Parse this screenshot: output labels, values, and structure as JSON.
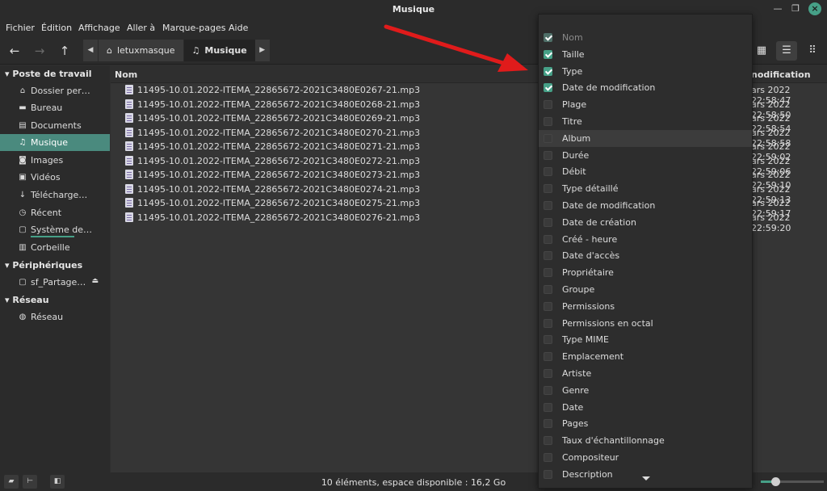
{
  "window": {
    "title": "Musique"
  },
  "menu": [
    "Fichier",
    "Édition",
    "Affichage",
    "Aller à",
    "Marque-pages",
    "Aide"
  ],
  "breadcrumbs": [
    {
      "label": "letuxmasque",
      "icon": "home-icon"
    },
    {
      "label": "Musique",
      "icon": "music-note-icon"
    }
  ],
  "sidebar": {
    "sections": [
      {
        "title": "Poste de travail",
        "items": [
          {
            "label": "Dossier per…",
            "icon": "home-folder-icon"
          },
          {
            "label": "Bureau",
            "icon": "desktop-icon"
          },
          {
            "label": "Documents",
            "icon": "documents-icon"
          },
          {
            "label": "Musique",
            "icon": "music-note-icon",
            "selected": true
          },
          {
            "label": "Images",
            "icon": "camera-icon"
          },
          {
            "label": "Vidéos",
            "icon": "video-icon"
          },
          {
            "label": "Télécharge…",
            "icon": "download-icon"
          },
          {
            "label": "Récent",
            "icon": "history-icon"
          },
          {
            "label": "Système de…",
            "icon": "drive-icon"
          },
          {
            "label": "Corbeille",
            "icon": "trash-icon"
          }
        ]
      },
      {
        "title": "Périphériques",
        "items": [
          {
            "label": "sf_Partage…",
            "icon": "drive-icon"
          }
        ]
      },
      {
        "title": "Réseau",
        "items": [
          {
            "label": "Réseau",
            "icon": "network-icon"
          }
        ]
      }
    ]
  },
  "columns": {
    "name": "Nom",
    "modified": "nodification"
  },
  "files": [
    {
      "name": "11495-10.01.2022-ITEMA_22865672-2021C3480E0267-21.mp3",
      "date": "ars 2022 22:58:47"
    },
    {
      "name": "11495-10.01.2022-ITEMA_22865672-2021C3480E0268-21.mp3",
      "date": "ars 2022 22:58:50"
    },
    {
      "name": "11495-10.01.2022-ITEMA_22865672-2021C3480E0269-21.mp3",
      "date": "ars 2022 22:58:54"
    },
    {
      "name": "11495-10.01.2022-ITEMA_22865672-2021C3480E0270-21.mp3",
      "date": "ars 2022 22:58:58"
    },
    {
      "name": "11495-10.01.2022-ITEMA_22865672-2021C3480E0271-21.mp3",
      "date": "ars 2022 22:59:02"
    },
    {
      "name": "11495-10.01.2022-ITEMA_22865672-2021C3480E0272-21.mp3",
      "date": "ars 2022 22:59:06"
    },
    {
      "name": "11495-10.01.2022-ITEMA_22865672-2021C3480E0273-21.mp3",
      "date": "ars 2022 22:59:10"
    },
    {
      "name": "11495-10.01.2022-ITEMA_22865672-2021C3480E0274-21.mp3",
      "date": "ars 2022 22:59:13"
    },
    {
      "name": "11495-10.01.2022-ITEMA_22865672-2021C3480E0275-21.mp3",
      "date": "ars 2022 22:59:17"
    },
    {
      "name": "11495-10.01.2022-ITEMA_22865672-2021C3480E0276-21.mp3",
      "date": "ars 2022 22:59:20"
    }
  ],
  "column_menu": [
    {
      "label": "Nom",
      "checked": true,
      "disabled": true
    },
    {
      "label": "Taille",
      "checked": true
    },
    {
      "label": "Type",
      "checked": true
    },
    {
      "label": "Date de modification",
      "checked": true
    },
    {
      "label": "Plage",
      "checked": false
    },
    {
      "label": "Titre",
      "checked": false
    },
    {
      "label": "Album",
      "checked": false,
      "hover": true
    },
    {
      "label": "Durée",
      "checked": false
    },
    {
      "label": "Débit",
      "checked": false
    },
    {
      "label": "Type détaillé",
      "checked": false
    },
    {
      "label": "Date de modification",
      "checked": false
    },
    {
      "label": "Date de création",
      "checked": false
    },
    {
      "label": "Créé - heure",
      "checked": false
    },
    {
      "label": "Date d'accès",
      "checked": false
    },
    {
      "label": "Propriétaire",
      "checked": false
    },
    {
      "label": "Groupe",
      "checked": false
    },
    {
      "label": "Permissions",
      "checked": false
    },
    {
      "label": "Permissions en octal",
      "checked": false
    },
    {
      "label": "Type MIME",
      "checked": false
    },
    {
      "label": "Emplacement",
      "checked": false
    },
    {
      "label": "Artiste",
      "checked": false
    },
    {
      "label": "Genre",
      "checked": false
    },
    {
      "label": "Date",
      "checked": false
    },
    {
      "label": "Pages",
      "checked": false
    },
    {
      "label": "Taux d'échantillonnage",
      "checked": false
    },
    {
      "label": "Compositeur",
      "checked": false
    },
    {
      "label": "Description",
      "checked": false
    }
  ],
  "status": {
    "text": "10 éléments, espace disponible : 16,2 Go"
  },
  "zoom": {
    "level": 0.2
  },
  "colors": {
    "accent": "#46a087",
    "selection": "#4a8a7e",
    "annotation_arrow": "#e01b1b"
  }
}
